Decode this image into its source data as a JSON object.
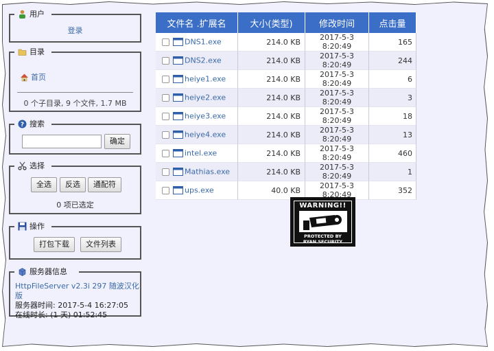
{
  "sidebar": {
    "user": {
      "title": "用户",
      "login_link": "登录"
    },
    "directory": {
      "title": "目录",
      "home_link": "首页",
      "summary": "0 个子目录, 9 个文件, 1.7 MB"
    },
    "search": {
      "title": "搜索",
      "input_value": "",
      "submit_label": "确定"
    },
    "select": {
      "title": "选择",
      "select_all": "全选",
      "invert": "反选",
      "wildcard": "通配符",
      "status": "0 项已选定"
    },
    "actions": {
      "title": "操作",
      "archive": "打包下载",
      "file_list": "文件列表"
    },
    "server": {
      "title": "服务器信息",
      "version_link": "HttpFileServer v2.3i 297 随波汉化版",
      "time": "服务器时间: 2017-5-4 16:27:05",
      "uptime": "在线时长: (1 天) 01:52:45"
    }
  },
  "table": {
    "headers": [
      "文件名 .扩展名",
      "大小(类型)",
      "修改时间",
      "点击量"
    ],
    "rows": [
      {
        "name": "DNS1.exe",
        "size": "214.0 KB",
        "modified": "2017-5-3 8:20:49",
        "hits": "165"
      },
      {
        "name": "DNS2.exe",
        "size": "214.0 KB",
        "modified": "2017-5-3 8:20:49",
        "hits": "244"
      },
      {
        "name": "heiye1.exe",
        "size": "214.0 KB",
        "modified": "2017-5-3 8:20:49",
        "hits": "6"
      },
      {
        "name": "heiye2.exe",
        "size": "214.0 KB",
        "modified": "2017-5-3 8:20:49",
        "hits": "3"
      },
      {
        "name": "heiye3.exe",
        "size": "214.0 KB",
        "modified": "2017-5-3 8:20:49",
        "hits": "18"
      },
      {
        "name": "heiye4.exe",
        "size": "214.0 KB",
        "modified": "2017-5-3 8:20:49",
        "hits": "13"
      },
      {
        "name": "intel.exe",
        "size": "214.0 KB",
        "modified": "2017-5-3 8:20:49",
        "hits": "460"
      },
      {
        "name": "Mathias.exe",
        "size": "214.0 KB",
        "modified": "2017-5-3 8:20:49",
        "hits": "1"
      },
      {
        "name": "ups.exe",
        "size": "40.0 KB",
        "modified": "2017-5-3 8:20:49",
        "hits": "352"
      }
    ]
  },
  "warning_sign": {
    "top_text": "WARNING!!",
    "bottom_line1": "PROTECTED BY",
    "bottom_line2": "RYAN SECURITY"
  },
  "colors": {
    "header_bg": "#3b6ec6",
    "link": "#3a6aa8",
    "page_bg": "#f1f1fd"
  }
}
